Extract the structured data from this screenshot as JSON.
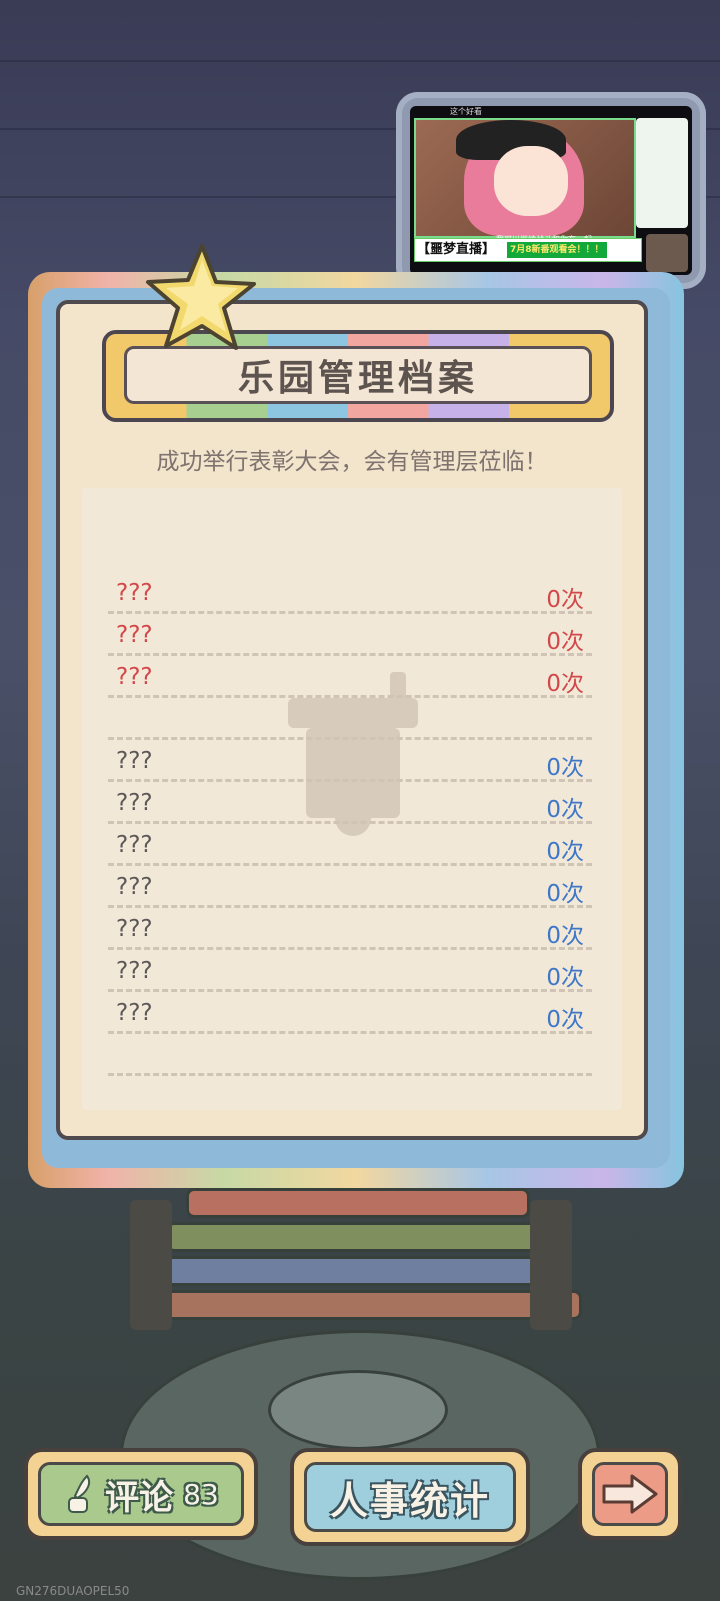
{
  "pip": {
    "top_caption": "这个好看",
    "subtitle": "我可以继续战斗和你在一起",
    "banner_name": "【噩梦",
    "banner_live": "直播】",
    "banner_tag": "7月8新番观看会！！！"
  },
  "archive": {
    "title": "乐园管理档案",
    "subtitle": "成功举行表彰大会，会有管理层莅临！",
    "red_rows": [
      {
        "name": "???",
        "count": "0次"
      },
      {
        "name": "???",
        "count": "0次"
      },
      {
        "name": "???",
        "count": "0次"
      }
    ],
    "grey_rows": [
      {
        "name": "???",
        "count": "0次"
      },
      {
        "name": "???",
        "count": "0次"
      },
      {
        "name": "???",
        "count": "0次"
      },
      {
        "name": "???",
        "count": "0次"
      },
      {
        "name": "???",
        "count": "0次"
      },
      {
        "name": "???",
        "count": "0次"
      },
      {
        "name": "???",
        "count": "0次"
      }
    ]
  },
  "buttons": {
    "comment_label": "评论",
    "comment_count": "83",
    "stats_label": "人事统计",
    "next_icon": "arrow-right-icon",
    "comment_icon": "quill-ink-icon"
  },
  "footer": {
    "build_id": "GN276DUAOPEL50"
  },
  "colors": {
    "red_text": "#d2484a",
    "blue_text": "#3f77c8",
    "panel_bg": "#f3e4cc"
  }
}
